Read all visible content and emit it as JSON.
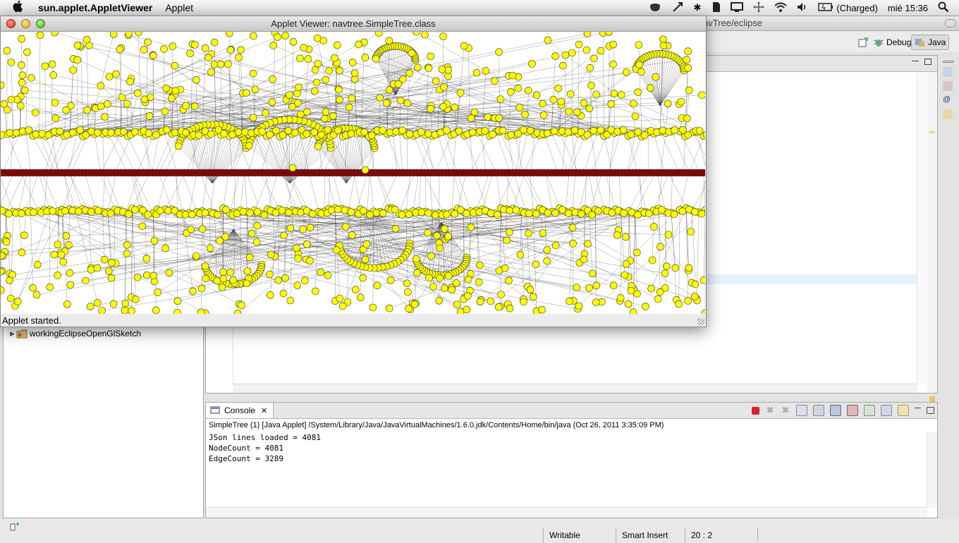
{
  "menubar": {
    "app_name": "sun.applet.AppletViewer",
    "menus": [
      "Applet"
    ],
    "battery": "(Charged)",
    "clock": "mié 15:36"
  },
  "eclipse": {
    "title_fragment": "avTree/eclipse",
    "perspectives": {
      "debug": "Debug",
      "java": "Java"
    },
    "tree_item": "workingEclipseOpenGlSketch"
  },
  "console": {
    "tab_label": "Console",
    "info": "SimpleTree (1) [Java Applet] /System/Library/Java/JavaVirtualMachines/1.6.0.jdk/Contents/Home/bin/java (Oct 26, 2011 3:35:09 PM)",
    "lines": [
      "JSon lines loaded = 4081",
      "NodeCount = 4081",
      "EdgeCount = 3289"
    ]
  },
  "statusbar": {
    "writable": "Writable",
    "insert_mode": "Smart Insert",
    "position": "20 : 2"
  },
  "applet": {
    "title": "Applet Viewer: navtree.SimpleTree.class",
    "status": "Applet started.",
    "node_color": "#ffff00",
    "root_color": "#8b0000"
  }
}
